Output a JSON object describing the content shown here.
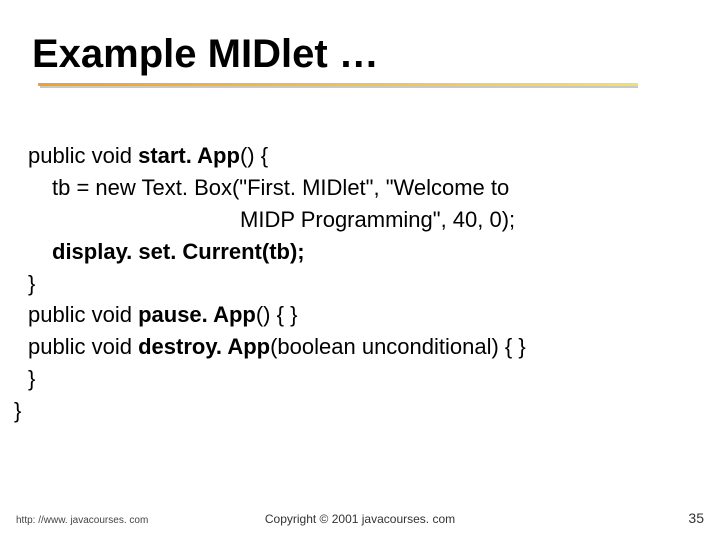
{
  "title": "Example MIDlet …",
  "code": {
    "l1_prefix": "public void ",
    "l1_bold": "start. App",
    "l1_suffix": "() {",
    "l2": "tb = new Text. Box(\"First. MIDlet\", \"Welcome to",
    "l3": "MIDP Programming\", 40, 0);",
    "l4": "display. set. Current(tb);",
    "l5": "}",
    "l6_prefix": "public void ",
    "l6_bold": "pause. App",
    "l6_suffix": "() { }",
    "l7_prefix": "public void ",
    "l7_bold": "destroy. App",
    "l7_suffix": "(boolean unconditional) { }",
    "l8": "}",
    "l9": "}"
  },
  "footer": {
    "left": "http: //www. javacourses. com",
    "center": "Copyright © 2001 javacourses. com",
    "page": "35"
  }
}
